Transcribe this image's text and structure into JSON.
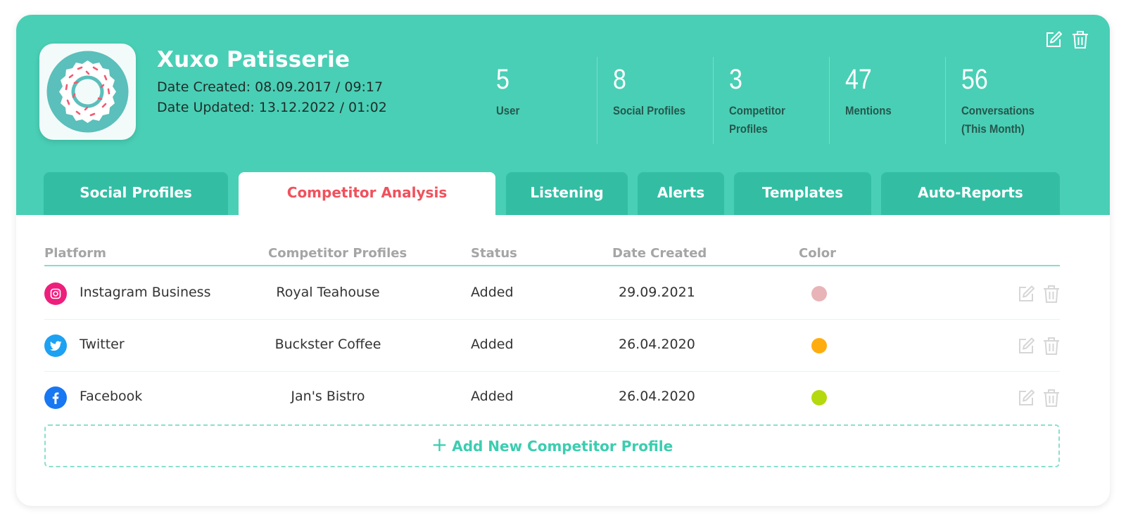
{
  "colors": {
    "header_bg": "#49cfb5",
    "tab_bg": "#33bea4",
    "active_tab_text": "#f0515d",
    "accent": "#3ccdb0"
  },
  "company": {
    "name": "Xuxo Patisserie",
    "date_created": "Date Created: 08.09.2017 / 09:17",
    "date_updated": "Date Updated: 13.12.2022 / 01:02",
    "logo_icon": "donut-icon"
  },
  "header_actions": [
    {
      "icon": "edit-icon"
    },
    {
      "icon": "trash-icon"
    }
  ],
  "stats": [
    {
      "value": "5",
      "label": "User"
    },
    {
      "value": "8",
      "label": "Social Profiles"
    },
    {
      "value": "3",
      "label": "Competitor Profiles"
    },
    {
      "value": "47",
      "label": "Mentions"
    },
    {
      "value": "56",
      "label": "Conversations (This Month)"
    }
  ],
  "tabs": [
    {
      "label": "Social Profiles",
      "active": false
    },
    {
      "label": "Competitor Analysis",
      "active": true
    },
    {
      "label": "Listening",
      "active": false
    },
    {
      "label": "Alerts",
      "active": false
    },
    {
      "label": "Templates",
      "active": false
    },
    {
      "label": "Auto-Reports",
      "active": false
    }
  ],
  "table": {
    "columns": [
      "Platform",
      "Competitor Profiles",
      "Status",
      "Date Created",
      "Color"
    ],
    "rows": [
      {
        "platform": "Instagram Business",
        "platform_icon": "instagram-icon",
        "competitor": "Royal Teahouse",
        "status": "Added",
        "date": "29.09.2021",
        "color": "#e8b4b8"
      },
      {
        "platform": "Twitter",
        "platform_icon": "twitter-icon",
        "competitor": "Buckster Coffee",
        "status": "Added",
        "date": "26.04.2020",
        "color": "#ffad0e"
      },
      {
        "platform": "Facebook",
        "platform_icon": "facebook-icon",
        "competitor": "Jan's Bistro",
        "status": "Added",
        "date": "26.04.2020",
        "color": "#b4d90f"
      }
    ]
  },
  "add_button": {
    "icon": "plus-icon",
    "label": "Add New Competitor Profile"
  }
}
